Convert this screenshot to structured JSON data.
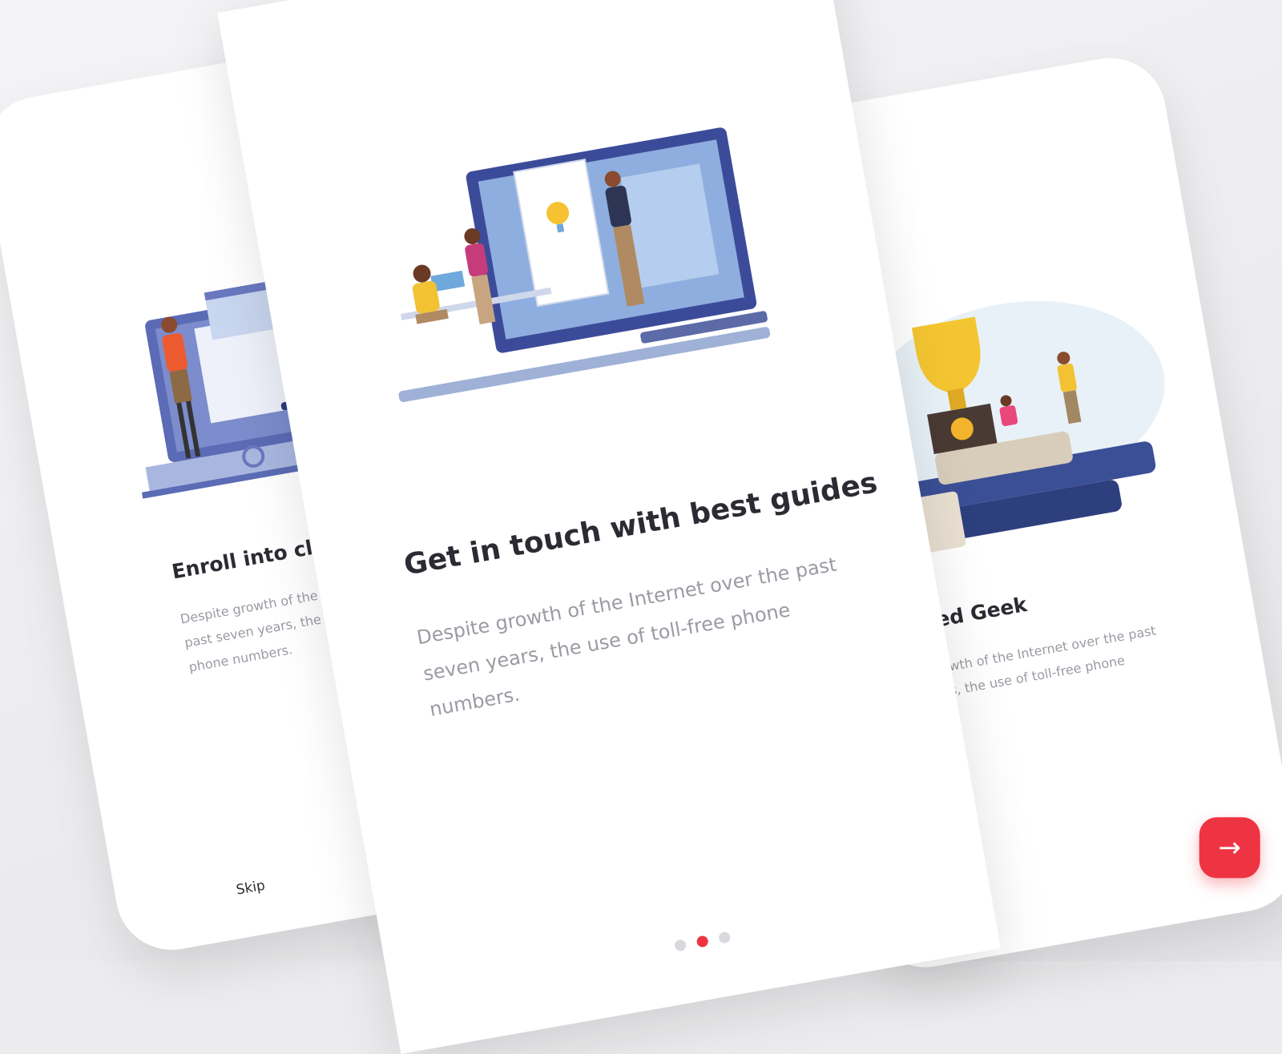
{
  "colors": {
    "accent": "#ee3443",
    "text": "#2b2c33",
    "muted": "#9a9ba3"
  },
  "screens": [
    {
      "title": "Enroll into classes",
      "description": "Despite growth of the Internet over the past seven years, the use of toll-free phone numbers.",
      "skip_label": "Skip",
      "illustration": "online-classes-illustration"
    },
    {
      "title": "Get in touch with best guides",
      "description": "Despite growth of the Internet over the past seven years, the use of toll-free phone numbers.",
      "illustration": "team-presentation-illustration",
      "pagination": {
        "count": 3,
        "active_index": 1
      }
    },
    {
      "title": "Certified Geek",
      "description": "Despite growth of the Internet over the past seven years, the use of toll-free phone numbers.",
      "illustration": "trophy-books-illustration",
      "next_icon": "arrow-right-icon",
      "next_glyph": "→"
    }
  ]
}
